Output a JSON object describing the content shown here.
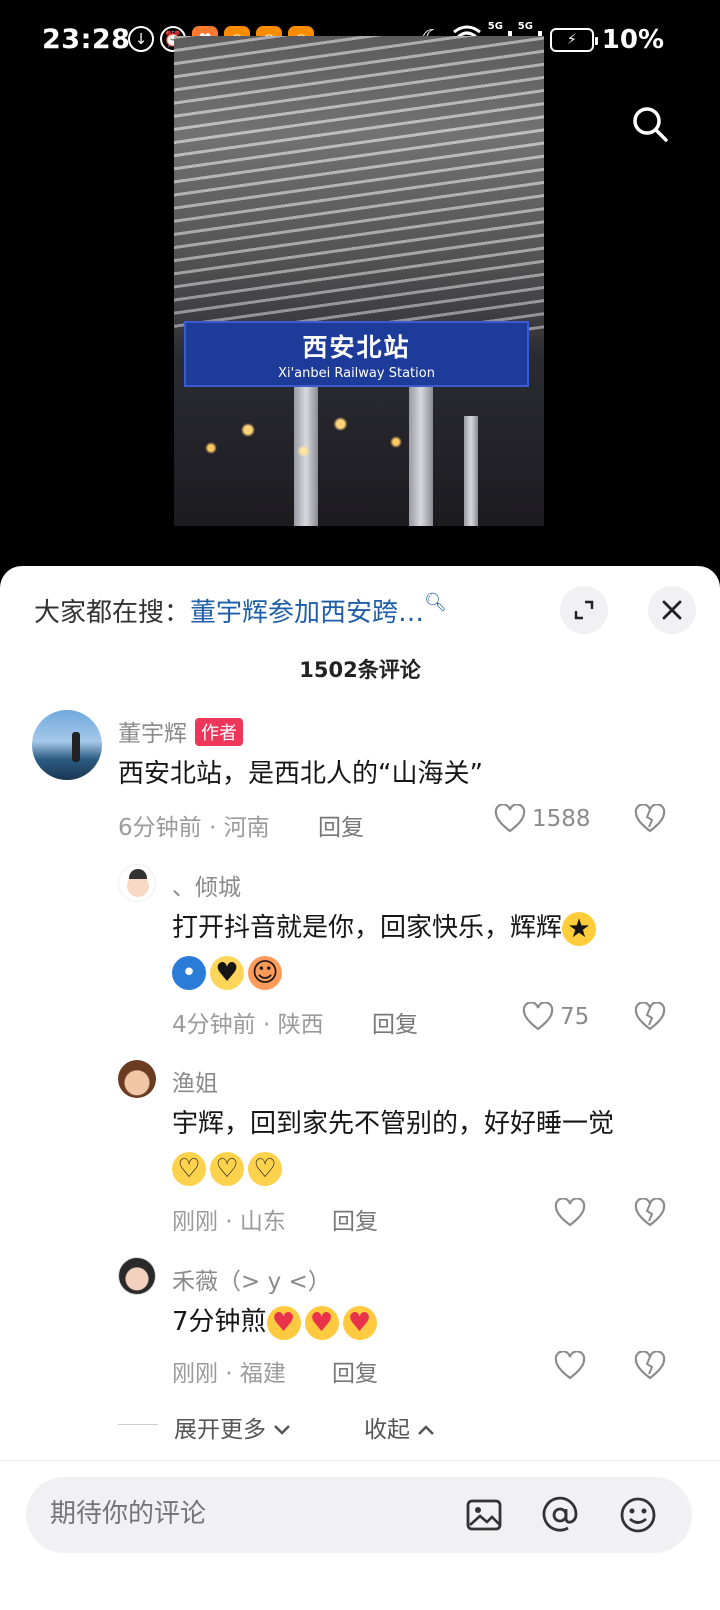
{
  "status_bar": {
    "time": "23:28",
    "battery": "10%",
    "network_1": "5G",
    "network_2": "5G"
  },
  "video": {
    "sign_cn": "西安北站",
    "sign_en": "Xi'anbei Railway Station"
  },
  "sheet": {
    "hot_search_label": "大家都在搜：",
    "hot_search_query": "董宇辉参加西安跨…",
    "comment_count": "1502条评论"
  },
  "comments": [
    {
      "name": "董宇辉",
      "badge": "作者",
      "text": "西安北站，是西北人的“山海关”",
      "meta": "6分钟前 · 河南",
      "reply": "回复",
      "likes": "1588"
    },
    {
      "name": "、倾城",
      "text": "打开抖音就是你，回家快乐，辉辉",
      "meta": "4分钟前 · 陕西",
      "reply": "回复",
      "likes": "75"
    },
    {
      "name": "渔姐",
      "text": "宇辉，回到家先不管别的，好好睡一觉",
      "meta": "刚刚 · 山东",
      "reply": "回复",
      "likes": ""
    },
    {
      "name": "禾薇（> y <）",
      "text": "7分钟煎",
      "meta": "刚刚 · 福建",
      "reply": "回复",
      "likes": ""
    }
  ],
  "thread": {
    "expand_more": "展开更多",
    "collapse": "收起"
  },
  "input": {
    "placeholder": "期待你的评论"
  },
  "icons": {
    "search": "search-icon",
    "expand": "expand-icon",
    "close": "close-icon",
    "heart": "heart-icon",
    "dislike": "broken-heart-icon",
    "image": "image-icon",
    "at": "at-icon",
    "emoji": "emoji-icon"
  }
}
